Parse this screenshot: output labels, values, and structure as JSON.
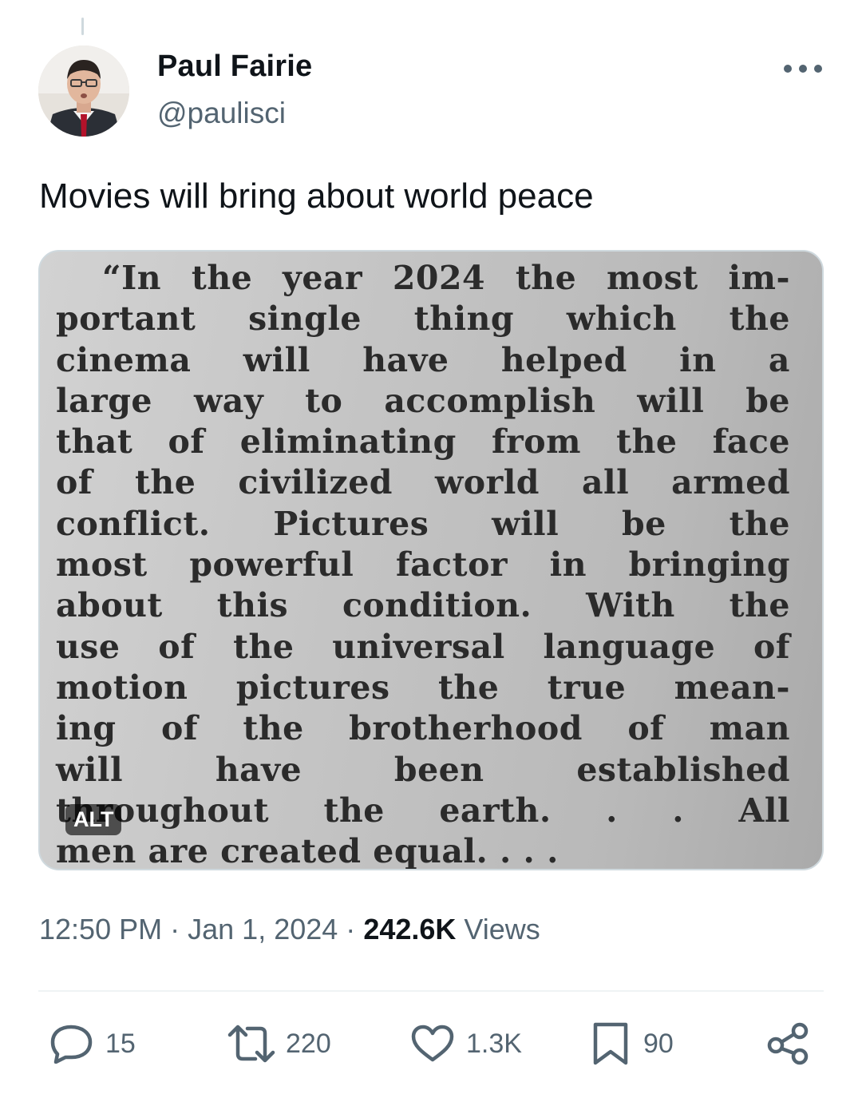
{
  "author": {
    "name": "Paul Fairie",
    "handle": "@paulisci",
    "avatar_icon": "avatar-photo"
  },
  "tweet": {
    "text": "Movies will bring about world peace",
    "media": {
      "alt_badge": "ALT",
      "clipping_lines": [
        "“In the year 2024 the most im-",
        "portant single thing which the",
        "cinema will have helped in a",
        "large way to accomplish will be",
        "that of eliminating from the face",
        "of the civilized world all armed",
        "conflict. Pictures will be the",
        "most powerful factor in bringing",
        "about this condition. With the",
        "use of the universal language of",
        "motion pictures the true mean-",
        "ing of the brotherhood of man",
        "will have been established",
        "throughout the earth. . . All",
        "men are created equal. . . ."
      ]
    },
    "time": "12:50 PM",
    "separator": "·",
    "date": "Jan 1, 2024",
    "views_count": "242.6K",
    "views_label": "Views"
  },
  "actions": {
    "replies": "15",
    "reposts": "220",
    "likes": "1.3K",
    "bookmarks": "90"
  },
  "colors": {
    "text": "#0f1419",
    "secondary": "#536471",
    "border": "#cfd9de"
  }
}
